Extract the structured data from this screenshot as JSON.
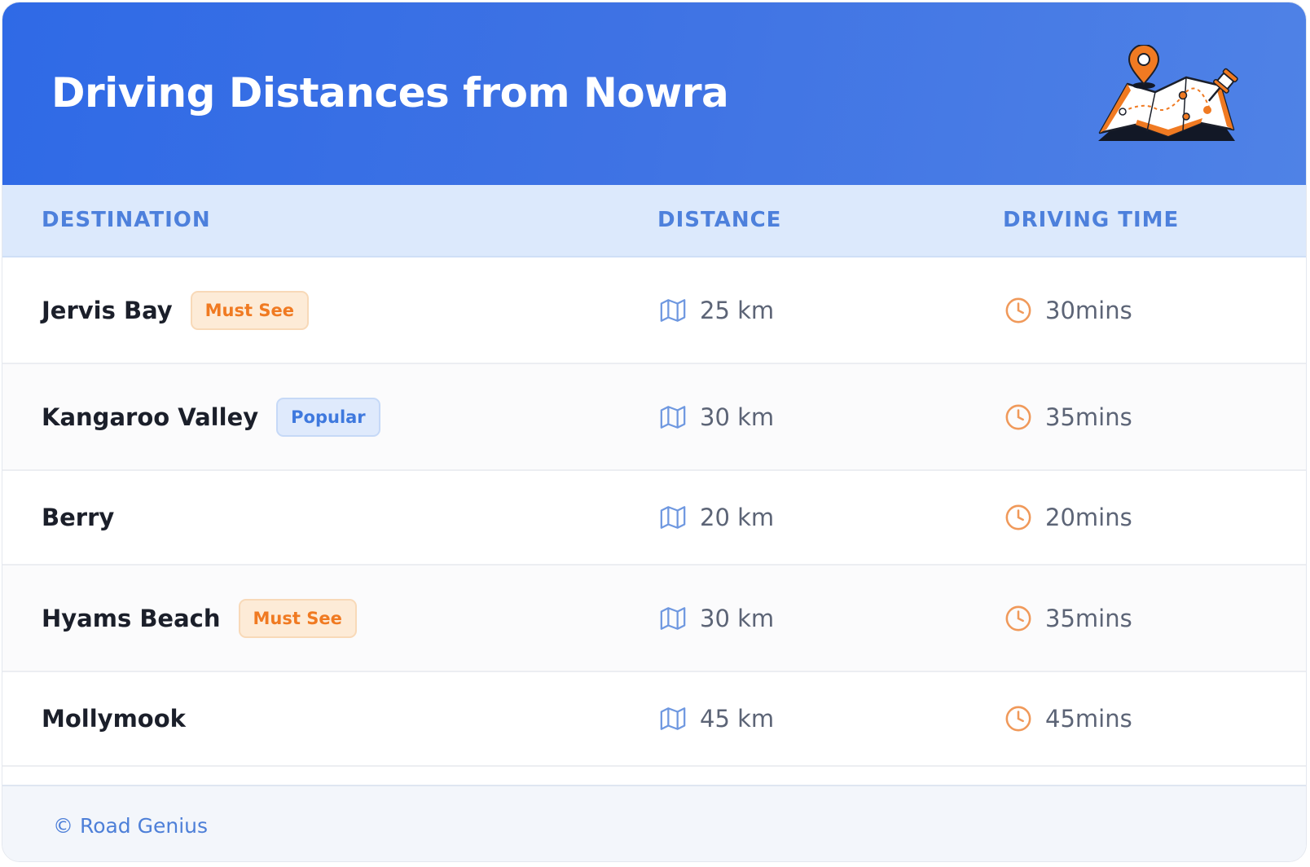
{
  "header": {
    "title": "Driving Distances from Nowra",
    "illustration": "map-with-pins-icon"
  },
  "table": {
    "columns": [
      "DESTINATION",
      "DISTANCE",
      "DRIVING TIME"
    ],
    "rows": [
      {
        "destination": "Jervis Bay",
        "badge": "Must See",
        "badge_type": "must-see",
        "distance": "25 km",
        "time": "30mins"
      },
      {
        "destination": "Kangaroo Valley",
        "badge": "Popular",
        "badge_type": "popular",
        "distance": "30 km",
        "time": "35mins"
      },
      {
        "destination": "Berry",
        "badge": null,
        "badge_type": null,
        "distance": "20 km",
        "time": "20mins"
      },
      {
        "destination": "Hyams Beach",
        "badge": "Must See",
        "badge_type": "must-see",
        "distance": "30 km",
        "time": "35mins"
      },
      {
        "destination": "Mollymook",
        "badge": null,
        "badge_type": null,
        "distance": "45 km",
        "time": "45mins"
      }
    ],
    "distance_icon": "map-icon",
    "time_icon": "clock-icon"
  },
  "footer": {
    "text": "© Road Genius"
  },
  "colors": {
    "header_gradient_start": "#2f6ae6",
    "header_gradient_end": "#4f82e6",
    "table_header_bg": "#dce9fc",
    "accent_blue": "#4d80dc",
    "accent_orange": "#f07a22"
  }
}
